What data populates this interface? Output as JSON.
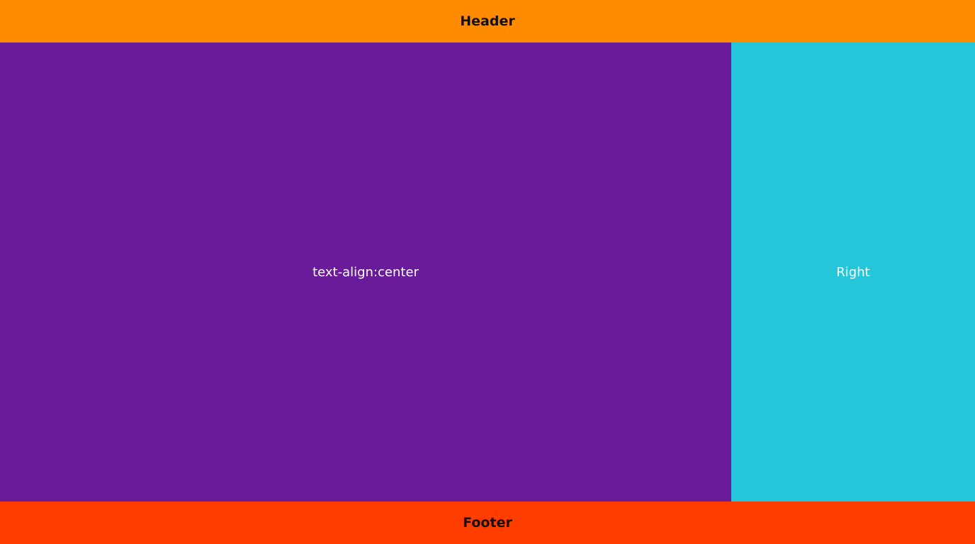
{
  "header": {
    "label": "Header",
    "color": "#FF8C00"
  },
  "main": {
    "label": "text-align:center",
    "color": "#6A1B9A"
  },
  "right": {
    "label": "Right",
    "color": "#26C6DA"
  },
  "footer": {
    "label": "Footer",
    "color": "#FF3D00"
  }
}
